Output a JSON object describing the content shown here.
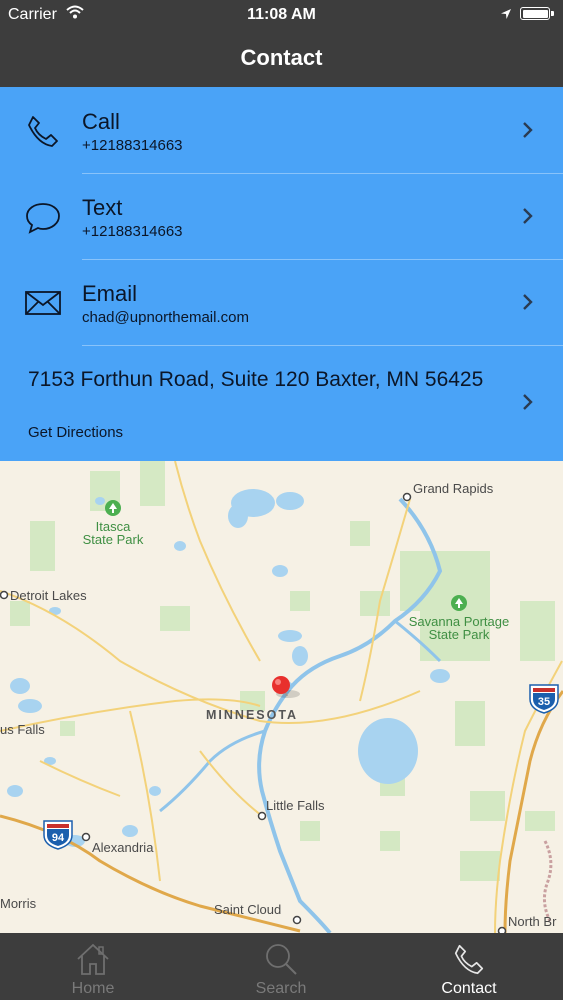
{
  "status": {
    "carrier": "Carrier",
    "time": "11:08 AM"
  },
  "nav": {
    "title": "Contact"
  },
  "contact": {
    "call": {
      "label": "Call",
      "value": "+12188314663",
      "icon": "phone-icon"
    },
    "text": {
      "label": "Text",
      "value": "+12188314663",
      "icon": "chat-bubble-icon"
    },
    "email": {
      "label": "Email",
      "value": "chad@upnorthemail.com",
      "icon": "envelope-icon"
    },
    "address": {
      "line": "7153 Forthun Road, Suite 120 Baxter, MN 56425",
      "action": "Get Directions"
    }
  },
  "map": {
    "labels": {
      "grand_rapids": "Grand Rapids",
      "itasca": "Itasca",
      "state_park": "State Park",
      "detroit_lakes": "Detroit Lakes",
      "savanna": "Savanna Portage",
      "minnesota": "MINNESOTA",
      "us_falls": "us Falls",
      "little_falls": "Little Falls",
      "alexandria": "Alexandria",
      "morris": "Morris",
      "saint_cloud": "Saint Cloud",
      "north_br": "North Br",
      "i35": "35",
      "i94": "94"
    }
  },
  "tabs": [
    {
      "label": "Home",
      "icon": "home-icon",
      "active": false
    },
    {
      "label": "Search",
      "icon": "search-icon",
      "active": false
    },
    {
      "label": "Contact",
      "icon": "phone-icon",
      "active": true
    }
  ],
  "colors": {
    "accent": "#4aa3f7",
    "bar": "#3d3d3d",
    "pin": "#e8302d"
  }
}
